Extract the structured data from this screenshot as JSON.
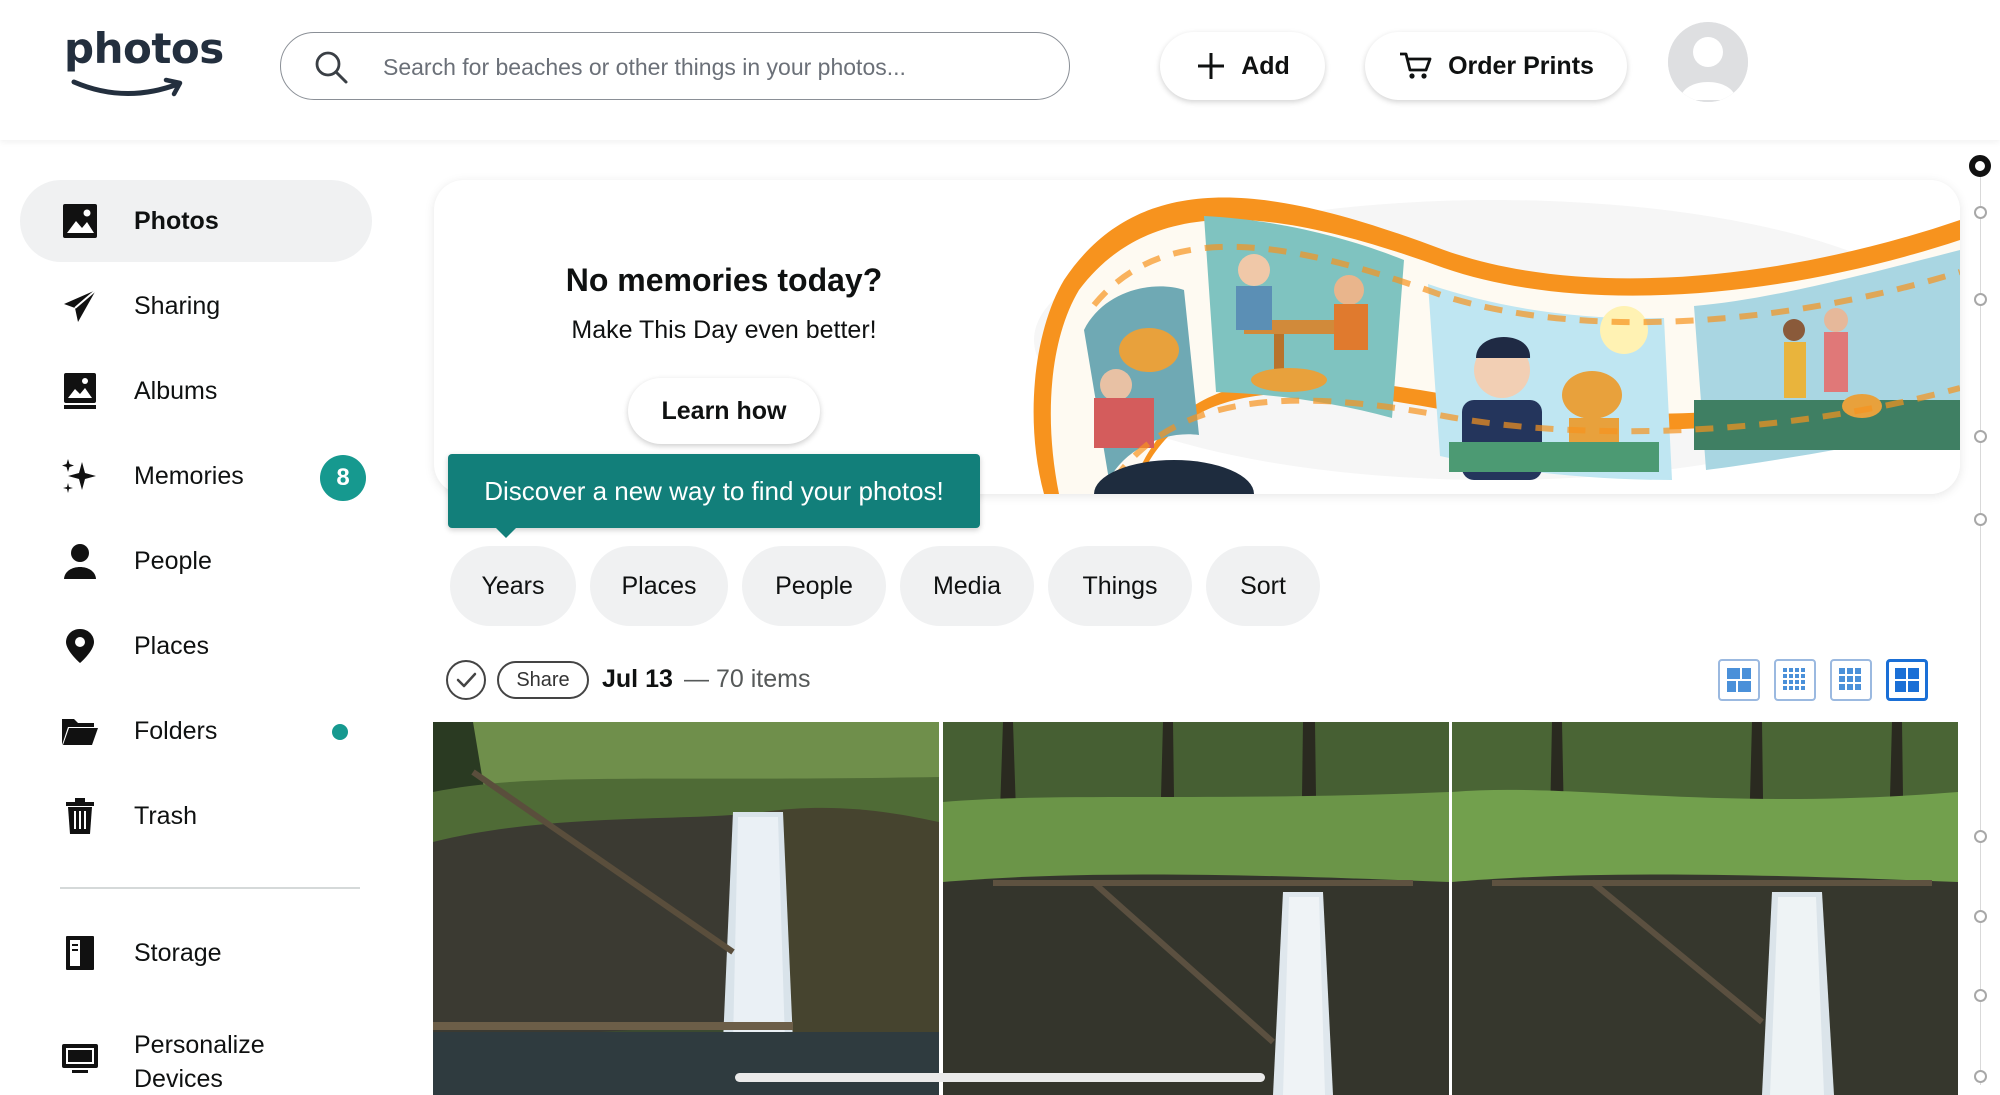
{
  "header": {
    "logo_text": "photos",
    "search_placeholder": "Search for beaches or other things in your photos...",
    "add_label": "Add",
    "order_prints_label": "Order Prints"
  },
  "sidebar": {
    "items": [
      {
        "label": "Photos",
        "icon": "image-icon",
        "active": true
      },
      {
        "label": "Sharing",
        "icon": "paper-plane-icon"
      },
      {
        "label": "Albums",
        "icon": "album-icon"
      },
      {
        "label": "Memories",
        "icon": "sparkle-icon",
        "badge": "8"
      },
      {
        "label": "People",
        "icon": "person-icon"
      },
      {
        "label": "Places",
        "icon": "location-pin-icon"
      },
      {
        "label": "Folders",
        "icon": "folder-icon",
        "dot": true
      },
      {
        "label": "Trash",
        "icon": "trash-icon"
      },
      {
        "label": "Storage",
        "icon": "storage-icon"
      },
      {
        "label": "Personalize\nDevices",
        "icon": "monitor-icon"
      }
    ]
  },
  "banner": {
    "title": "No memories today?",
    "subtitle": "Make This Day even better!",
    "button_label": "Learn how"
  },
  "tooltip": {
    "text": "Discover a new way to find your photos!"
  },
  "filters": [
    "Years",
    "Places",
    "People",
    "Media",
    "Things",
    "Sort"
  ],
  "date_group": {
    "share_label": "Share",
    "date": "Jul 13",
    "separator": "—",
    "count": "70 items"
  },
  "view_modes": [
    "large-mosaic-view-icon",
    "small-grid-view-icon",
    "medium-grid-view-icon",
    "large-grid-view-icon"
  ],
  "colors": {
    "accent_teal": "#16998f",
    "tooltip_bg": "#127f7a",
    "view_active": "#1a6fd6",
    "brand_orange": "#f7931e"
  }
}
